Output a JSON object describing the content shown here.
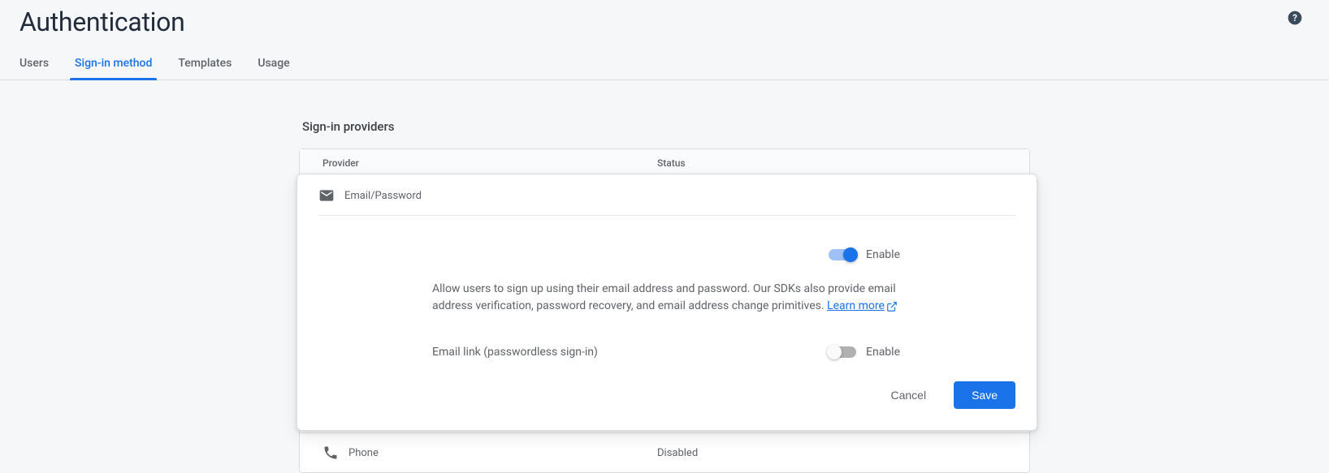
{
  "page": {
    "title": "Authentication"
  },
  "tabs": {
    "users": "Users",
    "signin": "Sign-in method",
    "templates": "Templates",
    "usage": "Usage"
  },
  "section": {
    "title": "Sign-in providers"
  },
  "table": {
    "header": {
      "provider": "Provider",
      "status": "Status"
    }
  },
  "expanded": {
    "provider_name": "Email/Password",
    "toggle1_label": "Enable",
    "description_part1": "Allow users to sign up using their email address and password. Our SDKs also provide email address verification, password recovery, and email address change primitives. ",
    "learn_more": "Learn more",
    "passwordless_label": "Email link (passwordless sign-in)",
    "toggle2_label": "Enable",
    "cancel": "Cancel",
    "save": "Save"
  },
  "providers": {
    "phone": {
      "name": "Phone",
      "status": "Disabled"
    }
  }
}
